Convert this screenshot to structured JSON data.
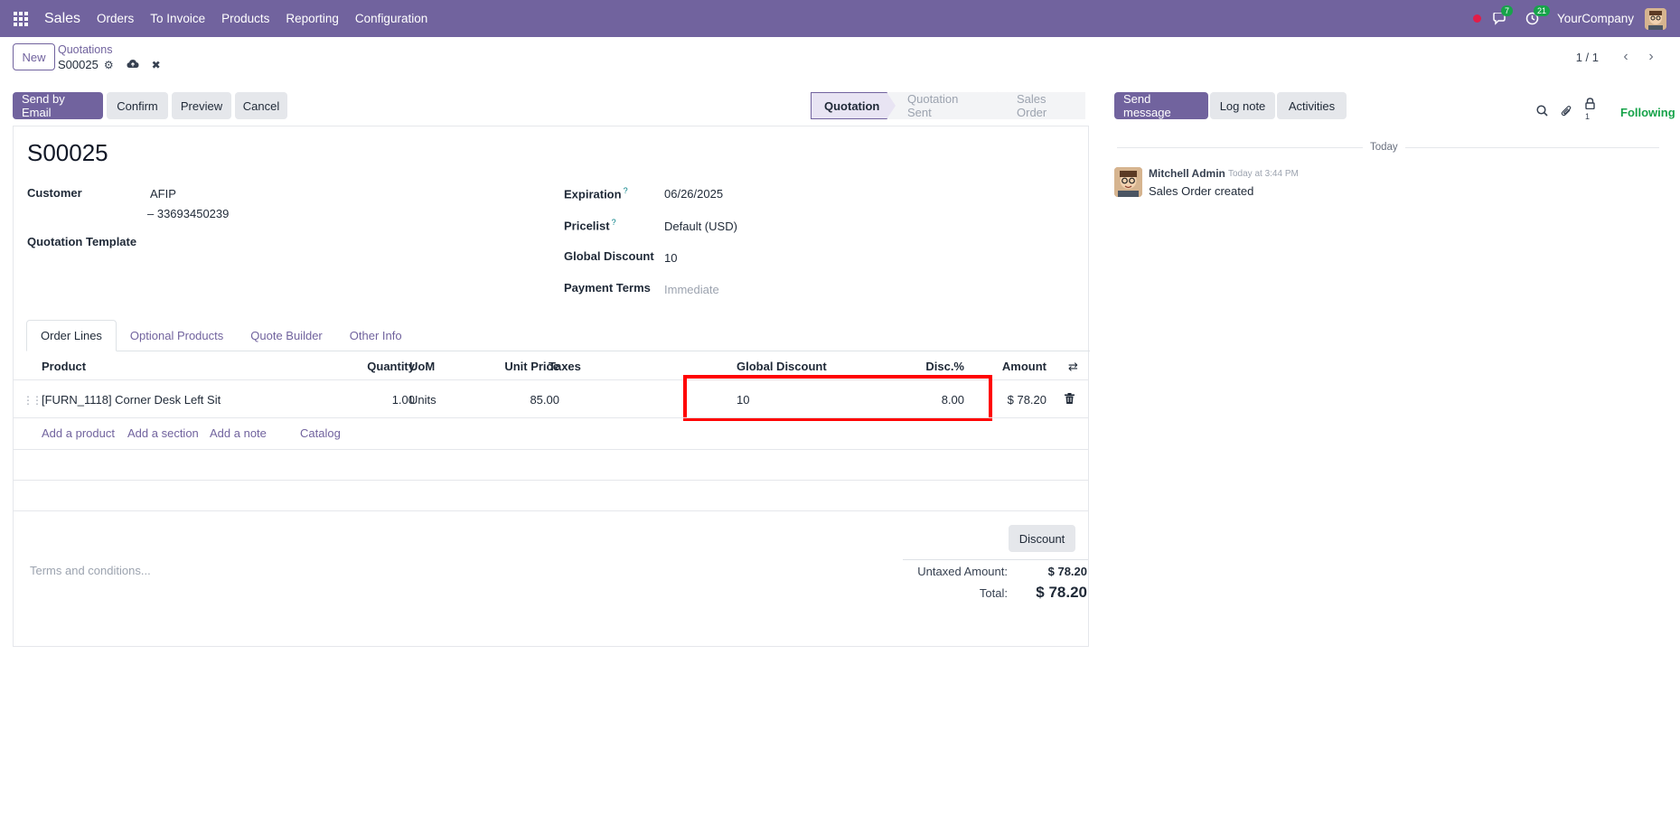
{
  "navbar": {
    "app_name": "Sales",
    "menu": [
      "Orders",
      "To Invoice",
      "Products",
      "Reporting",
      "Configuration"
    ],
    "messages_count": "7",
    "activities_count": "21",
    "company": "YourCompany"
  },
  "control_panel": {
    "new_label": "New",
    "breadcrumb_parent": "Quotations",
    "breadcrumb_current": "S00025",
    "pager_value": "1 / 1"
  },
  "statusbar": {
    "buttons": [
      "Send by Email",
      "Confirm",
      "Preview",
      "Cancel"
    ],
    "stages": [
      "Quotation",
      "Quotation Sent",
      "Sales Order"
    ],
    "active_stage": "Quotation"
  },
  "form": {
    "name": "S00025",
    "customer_label": "Customer",
    "customer_name": "AFIP",
    "customer_vat": "– 33693450239",
    "quotation_template_label": "Quotation Template",
    "expiration_label": "Expiration",
    "expiration_value": "06/26/2025",
    "pricelist_label": "Pricelist",
    "pricelist_value": "Default (USD)",
    "global_discount_label": "Global Discount",
    "global_discount_value": "10",
    "payment_terms_label": "Payment Terms",
    "payment_terms_placeholder": "Immediate",
    "help_mark": "?"
  },
  "tabs": [
    "Order Lines",
    "Optional Products",
    "Quote Builder",
    "Other Info"
  ],
  "order_lines": {
    "headers": {
      "product": "Product",
      "quantity": "Quantity",
      "uom": "UoM",
      "unit_price": "Unit Price",
      "taxes": "Taxes",
      "global_discount": "Global Discount",
      "disc": "Disc.%",
      "amount": "Amount"
    },
    "rows": [
      {
        "product": "[FURN_1118] Corner Desk Left Sit",
        "quantity": "1.00",
        "uom": "Units",
        "unit_price": "85.00",
        "taxes": "",
        "global_discount": "10",
        "disc": "8.00",
        "amount": "$ 78.20"
      }
    ],
    "add_links": [
      "Add a product",
      "Add a section",
      "Add a note",
      "Catalog"
    ]
  },
  "footer": {
    "discount_button": "Discount",
    "terms_placeholder": "Terms and conditions...",
    "untaxed_label": "Untaxed Amount:",
    "untaxed_value": "$ 78.20",
    "total_label": "Total:",
    "total_value": "$ 78.20"
  },
  "chatter": {
    "send_message": "Send message",
    "log_note": "Log note",
    "activities": "Activities",
    "followers_count": "1",
    "following": "Following",
    "date_separator": "Today",
    "messages": [
      {
        "author": "Mitchell Admin",
        "time": "Today at 3:44 PM",
        "body": "Sales Order created"
      }
    ]
  },
  "colors": {
    "brand": "#71639e",
    "highlight": "#ff0000",
    "following": "#17a34a"
  }
}
